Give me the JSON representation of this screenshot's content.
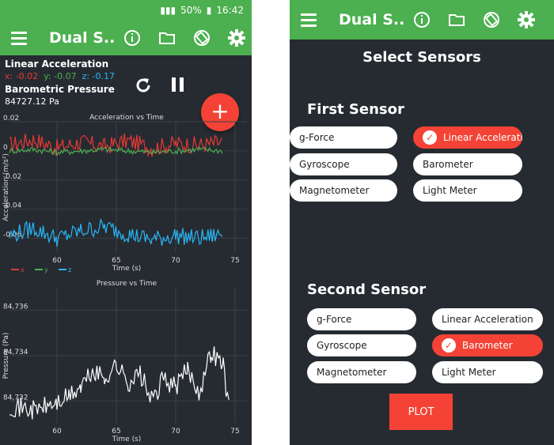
{
  "status_bar": {
    "battery": "50%",
    "time": "16:42"
  },
  "left": {
    "app_title": "Dual S...",
    "readings": {
      "accel_title": "Linear Acceleration",
      "x": "x: -0.02",
      "y": "y: -0.07",
      "z": "z: -0.17",
      "pressure_title": "Barometric Pressure",
      "pressure_value": "84727.12 Pa"
    },
    "fab_label": "+",
    "accel_chart": {
      "title": "Acceleration vs Time",
      "ylabel": "Acceleration (m/s²)",
      "xlabel": "Time (s)",
      "yticks": [
        "0.02",
        "0",
        "-0.02",
        "-0.04",
        "-0.06"
      ],
      "xticks": [
        "60",
        "65",
        "70",
        "75"
      ],
      "legend": [
        "x",
        "y",
        "z"
      ]
    },
    "pressure_chart": {
      "title": "Pressure vs Time",
      "ylabel": "Pressure (Pa)",
      "xlabel": "Time (s)",
      "yticks": [
        "84,736",
        "84,734",
        "84,732"
      ],
      "xticks": [
        "60",
        "65",
        "70",
        "75"
      ]
    }
  },
  "right": {
    "app_title": "Dual S...",
    "title": "Select Sensors",
    "first_heading": "First Sensor",
    "second_heading": "Second Sensor",
    "first_sensors": [
      {
        "label": "g-Force",
        "selected": false
      },
      {
        "label": "Linear Accelerati",
        "selected": true
      },
      {
        "label": "Gyroscope",
        "selected": false
      },
      {
        "label": "Barometer",
        "selected": false
      },
      {
        "label": "Magnetometer",
        "selected": false
      },
      {
        "label": "Light Meter",
        "selected": false
      }
    ],
    "second_sensors": [
      {
        "label": "g-Force",
        "selected": false
      },
      {
        "label": "Linear Acceleration",
        "selected": false
      },
      {
        "label": "Gyroscope",
        "selected": false
      },
      {
        "label": "Barometer",
        "selected": true
      },
      {
        "label": "Magnetometer",
        "selected": false
      },
      {
        "label": "Light Meter",
        "selected": false
      }
    ],
    "plot_label": "PLOT"
  },
  "colors": {
    "green": "#4caf50",
    "red": "#f44336",
    "x_series": "#e53935",
    "y_series": "#4caf50",
    "z_series": "#29b6f6",
    "background": "#262b31"
  },
  "chart_data": [
    {
      "type": "line",
      "title": "Acceleration vs Time",
      "xlabel": "Time (s)",
      "ylabel": "Acceleration (m/s²)",
      "xlim": [
        56,
        76
      ],
      "ylim": [
        -0.07,
        0.02
      ],
      "series": [
        {
          "name": "x",
          "description_values": [
            [
              56,
              0.004
            ],
            [
              58,
              0.008
            ],
            [
              60,
              0.002
            ],
            [
              62,
              0.006
            ],
            [
              64,
              0.003
            ],
            [
              66,
              0.007
            ],
            [
              68,
              0.002
            ],
            [
              70,
              0.005
            ],
            [
              72,
              0.004
            ],
            [
              74,
              0.006
            ]
          ]
        },
        {
          "name": "y",
          "description_values": [
            [
              56,
              0.0
            ],
            [
              58,
              0.001
            ],
            [
              60,
              -0.001
            ],
            [
              62,
              0.0
            ],
            [
              64,
              0.001
            ],
            [
              66,
              0.0
            ],
            [
              68,
              -0.001
            ],
            [
              70,
              0.0
            ],
            [
              72,
              0.001
            ],
            [
              74,
              0.0
            ]
          ]
        },
        {
          "name": "z",
          "description_values": [
            [
              56,
              -0.058
            ],
            [
              58,
              -0.053
            ],
            [
              60,
              -0.06
            ],
            [
              62,
              -0.055
            ],
            [
              64,
              -0.052
            ],
            [
              66,
              -0.057
            ],
            [
              68,
              -0.061
            ],
            [
              70,
              -0.058
            ],
            [
              72,
              -0.06
            ],
            [
              74,
              -0.057
            ]
          ]
        }
      ]
    },
    {
      "type": "line",
      "title": "Pressure vs Time",
      "xlabel": "Time (s)",
      "ylabel": "Pressure (Pa)",
      "xlim": [
        56,
        76
      ],
      "ylim": [
        84731,
        84737
      ],
      "series": [
        {
          "values": [
            [
              56,
              84731.8
            ],
            [
              58,
              84731.6
            ],
            [
              60,
              84731.9
            ],
            [
              61,
              84732.2
            ],
            [
              62,
              84732.6
            ],
            [
              63,
              84733.3
            ],
            [
              64,
              84733.0
            ],
            [
              65,
              84733.6
            ],
            [
              66,
              84732.8
            ],
            [
              67,
              84733.2
            ],
            [
              68,
              84732.0
            ],
            [
              69,
              84733.0
            ],
            [
              70,
              84732.6
            ],
            [
              71,
              84733.4
            ],
            [
              72,
              84732.4
            ],
            [
              73,
              84734.2
            ],
            [
              74,
              84733.6
            ],
            [
              74.6,
              84731.2
            ]
          ]
        }
      ]
    }
  ]
}
